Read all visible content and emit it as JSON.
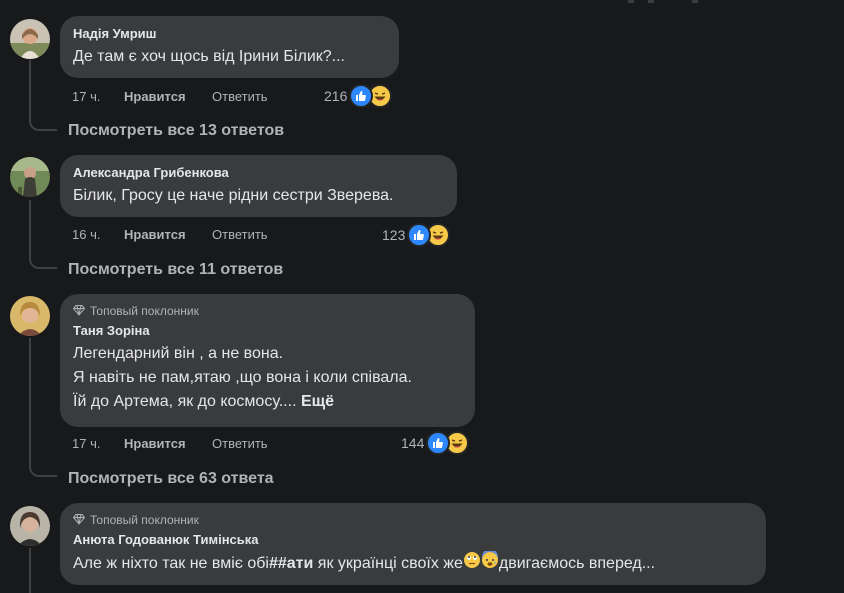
{
  "comments": [
    {
      "author": "Надія Умриш",
      "badge": "",
      "lines": [
        "Де там є хоч щось від Ірини Білик?..."
      ],
      "time": "17 ч.",
      "like_label": "Нравится",
      "reply_label": "Ответить",
      "reactions": "216",
      "view_replies": "Посмотреть все 13 ответов"
    },
    {
      "author": "Александра Грибенкова",
      "badge": "",
      "lines": [
        "Білик, Гросу це наче рідни сестри Зверева."
      ],
      "time": "16 ч.",
      "like_label": "Нравится",
      "reply_label": "Ответить",
      "reactions": "123",
      "view_replies": "Посмотреть все 11 ответов"
    },
    {
      "author": "Таня Зоріна",
      "badge": "Топовый поклонник",
      "lines": [
        "Легендарний він , а не вона.",
        "Я навіть не пам,ятаю ,що вона і коли співала.",
        "Їй до Артема, як до космосу...."
      ],
      "more_label": "Ещё",
      "time": "17 ч.",
      "like_label": "Нравится",
      "reply_label": "Ответить",
      "reactions": "144",
      "view_replies": "Посмотреть все 63 ответа"
    },
    {
      "author": "Анюта Годованюк Тимінська",
      "badge": "Топовый поклонник",
      "lines": [
        "Але ж ніхто так не вміє обі",
        "##ати",
        " як українці своїх же",
        "двигаємось вперед..."
      ]
    }
  ],
  "colors": {
    "background": "#18191a",
    "bubble": "#3a3b3c",
    "like_blue": "#2d88ff",
    "haha_yellow": "#f7c948",
    "secondary_text": "#b0b3b8"
  },
  "icons": [
    "like-reaction-icon",
    "haha-reaction-icon",
    "top-fan-diamond-icon",
    "eye-roll-emoji",
    "anxious-emoji"
  ]
}
